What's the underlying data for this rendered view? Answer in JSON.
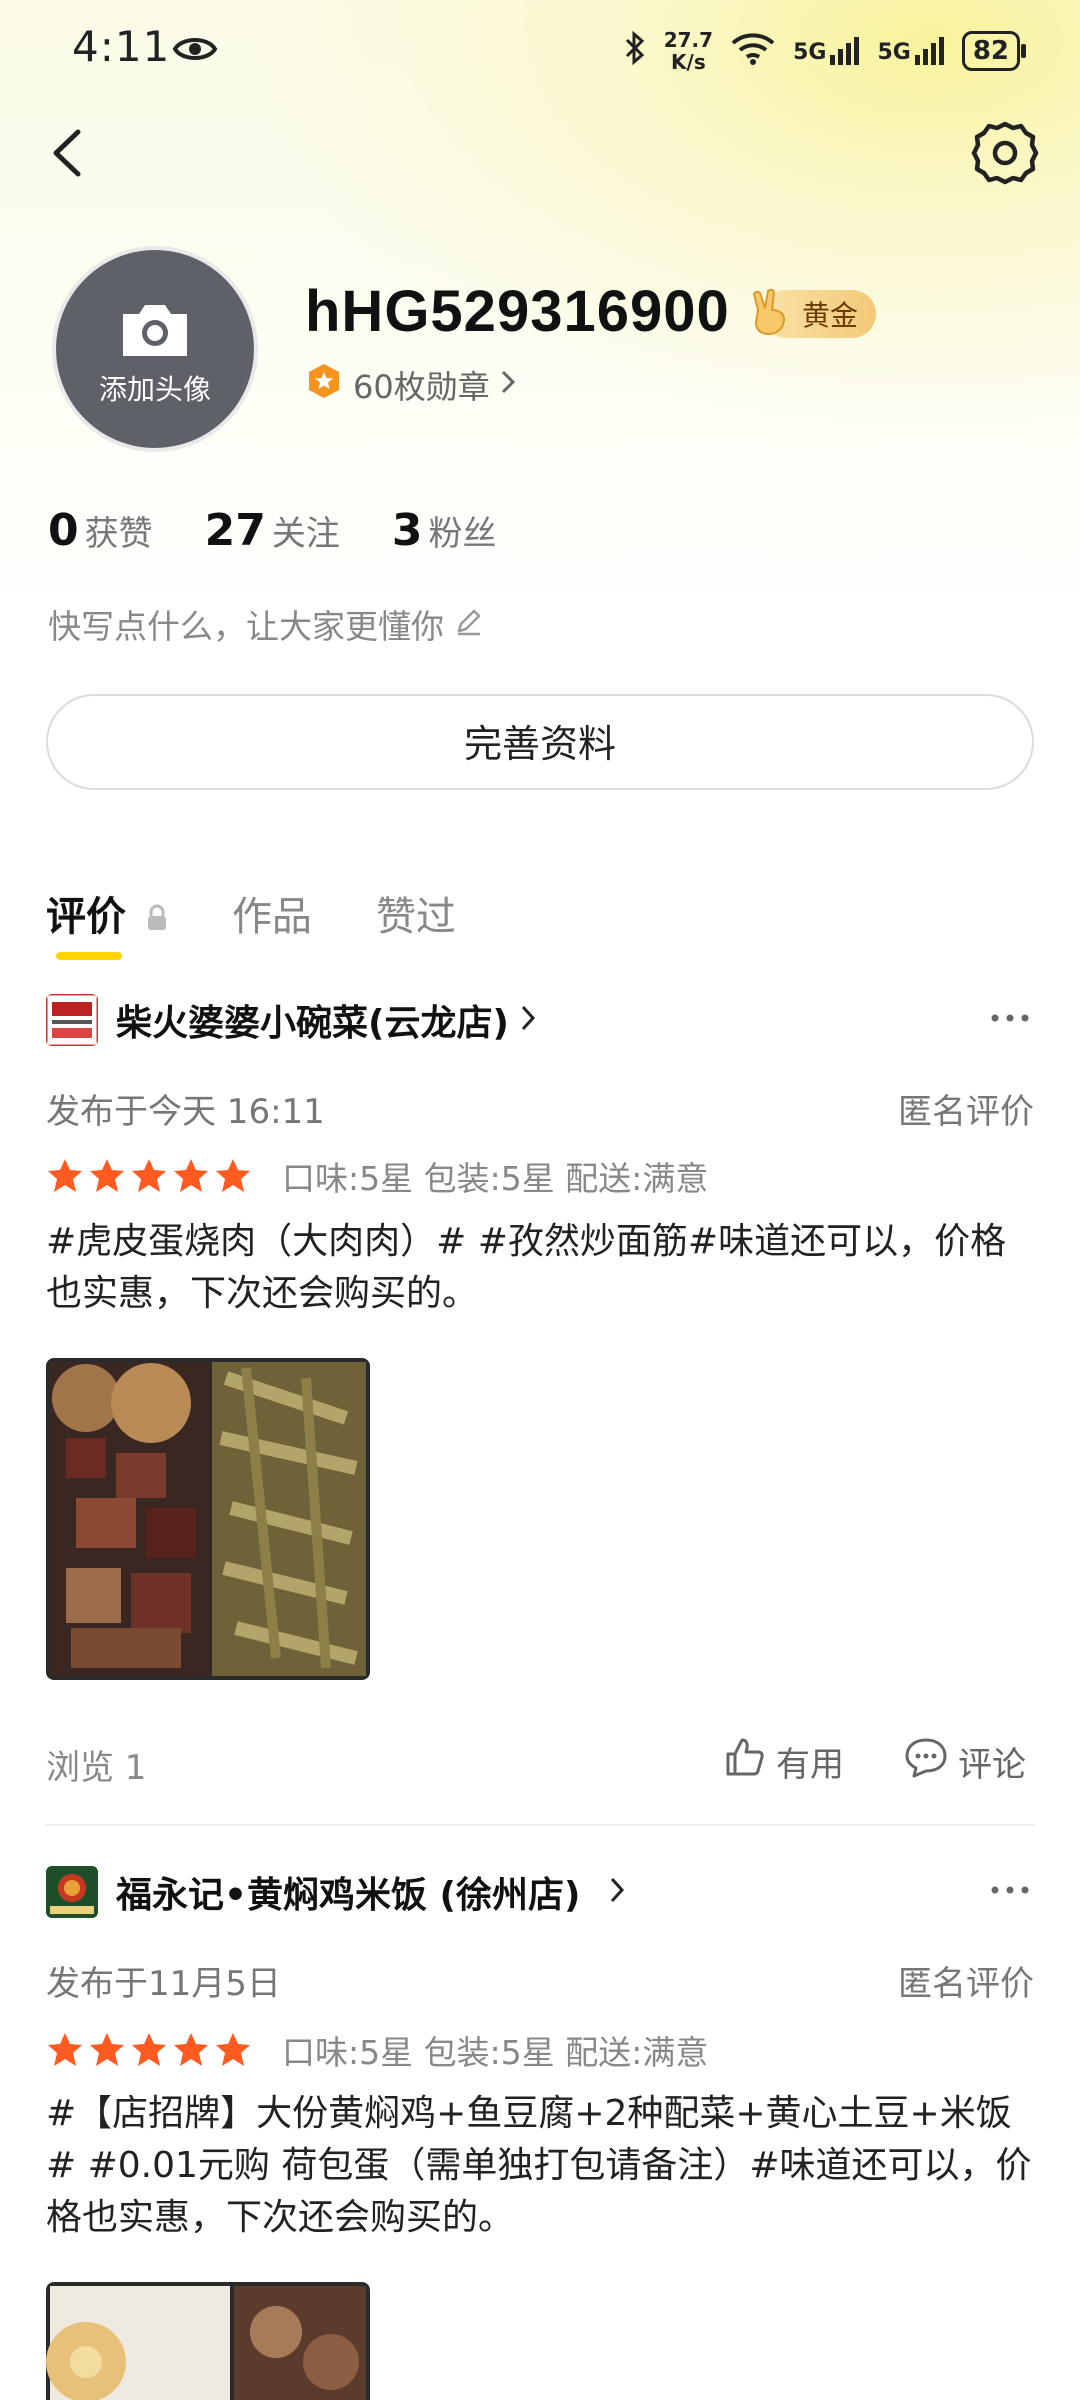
{
  "status_bar": {
    "time": "4:11",
    "net_speed_value": "27.7",
    "net_speed_unit": "K/s",
    "sim1": "5G",
    "sim2": "5G",
    "battery": "82"
  },
  "profile": {
    "avatar_label": "添加头像",
    "username": "hHG529316900",
    "level_badge": "黄金",
    "medals": "60枚勋章",
    "stats": [
      {
        "num": "0",
        "label": "获赞"
      },
      {
        "num": "27",
        "label": "关注"
      },
      {
        "num": "3",
        "label": "粉丝"
      }
    ],
    "bio_placeholder": "快写点什么，让大家更懂你",
    "complete_button": "完善资料"
  },
  "tabs": [
    {
      "label": "评价",
      "active": true
    },
    {
      "label": "作品",
      "active": false
    },
    {
      "label": "赞过",
      "active": false
    }
  ],
  "reviews": [
    {
      "shop": "柴火婆婆小碗菜(云龙店)",
      "posted": "发布于今天 16:11",
      "anonymous": "匿名评价",
      "rating_text": "口味:5星 包装:5星 配送:满意",
      "stars": 5,
      "text": "#虎皮蛋烧肉（大肉肉）# #孜然炒面筋#味道还可以，价格也实惠，下次还会购买的。",
      "views": "浏览 1",
      "useful": "有用",
      "comment": "评论"
    },
    {
      "shop": "福永记•黄焖鸡米饭 (徐州店)",
      "posted": "发布于11月5日",
      "anonymous": "匿名评价",
      "rating_text": "口味:5星 包装:5星 配送:满意",
      "stars": 5,
      "text": "#【店招牌】大份黄焖鸡+鱼豆腐+2种配菜+黄心土豆+米饭# #0.01元购 荷包蛋（需单独打包请备注）#味道还可以，价格也实惠，下次还会购买的。"
    }
  ],
  "colors": {
    "accent_yellow": "#ffd400",
    "star_orange": "#ff5a1f",
    "medal_orange": "#f7941d",
    "gold_badge": "#f3c977"
  }
}
